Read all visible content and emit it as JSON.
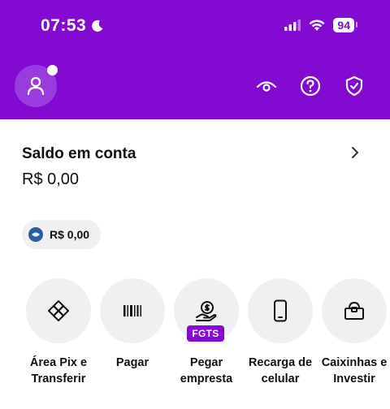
{
  "status_bar": {
    "time": "07:53",
    "battery": "94",
    "icons": [
      "moon-icon",
      "signal-icon",
      "wifi-icon",
      "battery-icon"
    ]
  },
  "header": {
    "avatar_icon": "user-icon",
    "icons": [
      "eye-icon",
      "help-icon",
      "shield-check-icon"
    ]
  },
  "account": {
    "title": "Saldo em conta",
    "value": "R$ 0,00"
  },
  "chip": {
    "value": "R$ 0,00"
  },
  "actions": [
    {
      "label_1": "Área Pix e",
      "label_2": "Transferir",
      "icon": "pix-icon"
    },
    {
      "label_1": "Pagar",
      "label_2": "",
      "icon": "barcode-icon"
    },
    {
      "label_1": "Pegar",
      "label_2": "empresta",
      "icon": "loan-hand-icon",
      "badge": "FGTS"
    },
    {
      "label_1": "Recarga de",
      "label_2": "celular",
      "icon": "phone-icon"
    },
    {
      "label_1": "Caixinhas e",
      "label_2": "Investir",
      "icon": "piggy-box-icon"
    }
  ],
  "colors": {
    "brand": "#820ad1",
    "surface": "#f0eff2",
    "text": "#111111"
  }
}
